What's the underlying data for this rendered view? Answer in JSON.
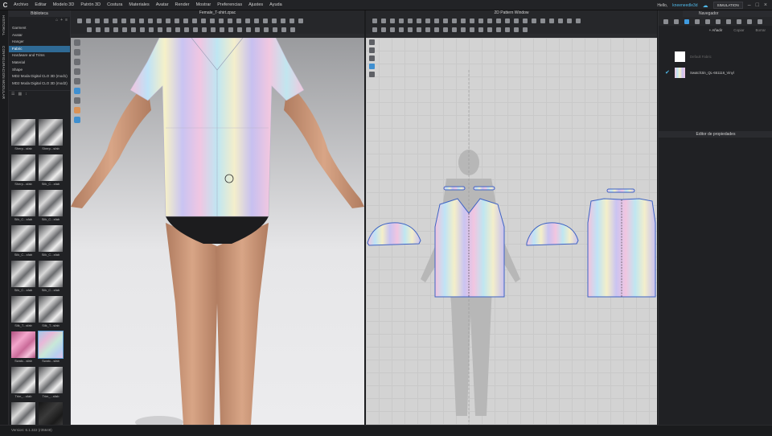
{
  "menubar": {
    "logo": "C",
    "items": [
      "Archivo",
      "Editar",
      "Modelo 3D",
      "Patrón 3D",
      "Costura",
      "Materiales",
      "Avatar",
      "Render",
      "Mostrar",
      "Preferencias",
      "Ajustes",
      "Ayuda"
    ],
    "greeting": "Hello,",
    "user": "kneeneedle3d",
    "simulation": "SIMULATION"
  },
  "vertical_tabs": [
    "HISTORIAL",
    "CONFIGURACION MODULAR"
  ],
  "library": {
    "title": "Biblioteca",
    "items": [
      "Garment",
      "Avatar",
      "Hanger",
      "Fabric",
      "Hardware and Trims",
      "Material",
      "Shape",
      "MD2 Moda Digital CLO 3D (mod1)",
      "MD2 Moda Digital CLO 3D (mod2)"
    ],
    "selected_index": 3,
    "thumbnails": [
      {
        "label": "Sherp...sfab",
        "style": "gray"
      },
      {
        "label": "Sherp...sfab",
        "style": "gray"
      },
      {
        "label": "Sherp...sfab",
        "style": "gray"
      },
      {
        "label": "Silk_C...sfab",
        "style": "gray"
      },
      {
        "label": "Silk_C...sfab",
        "style": "gray"
      },
      {
        "label": "Silk_C...sfab",
        "style": "gray"
      },
      {
        "label": "Silk_C...sfab",
        "style": "gray"
      },
      {
        "label": "Silk_C...sfab",
        "style": "gray"
      },
      {
        "label": "Silk_C...sfab",
        "style": "gray"
      },
      {
        "label": "Silk_C...sfab",
        "style": "gray"
      },
      {
        "label": "Silk_T...sfab",
        "style": "gray"
      },
      {
        "label": "Silk_T...sfab",
        "style": "gray"
      },
      {
        "label": "Swatc...sfab",
        "style": "pink"
      },
      {
        "label": "Swatc...sfab",
        "style": "holo"
      },
      {
        "label": "Trim_...sfab",
        "style": "gray"
      },
      {
        "label": "Trim_...sfab",
        "style": "gray"
      },
      {
        "label": "",
        "style": "gray"
      },
      {
        "label": "",
        "style": "dark"
      }
    ]
  },
  "viewport3d": {
    "title": "Female_T-shirt.zpac"
  },
  "viewport2d": {
    "title": "2D Pattern Window"
  },
  "object_browser": {
    "title": "Navegador",
    "add_label": "+ Añadir",
    "copy_label": "Copiar",
    "delete_label": "Borrar",
    "fabrics": [
      {
        "name": "Default Fabric",
        "swatch": "#ffffff",
        "applied": false
      },
      {
        "name": "Swatch3in_QL-651116_Vinyl",
        "swatch": "holo",
        "applied": true
      }
    ],
    "property_editor_title": "Editor de propiedades"
  },
  "status": {
    "version": "Version: 6.1.322 (r35648)"
  },
  "colors": {
    "accent": "#3f9be0",
    "selection": "#2f6a95",
    "user": "#4fb8e8"
  }
}
